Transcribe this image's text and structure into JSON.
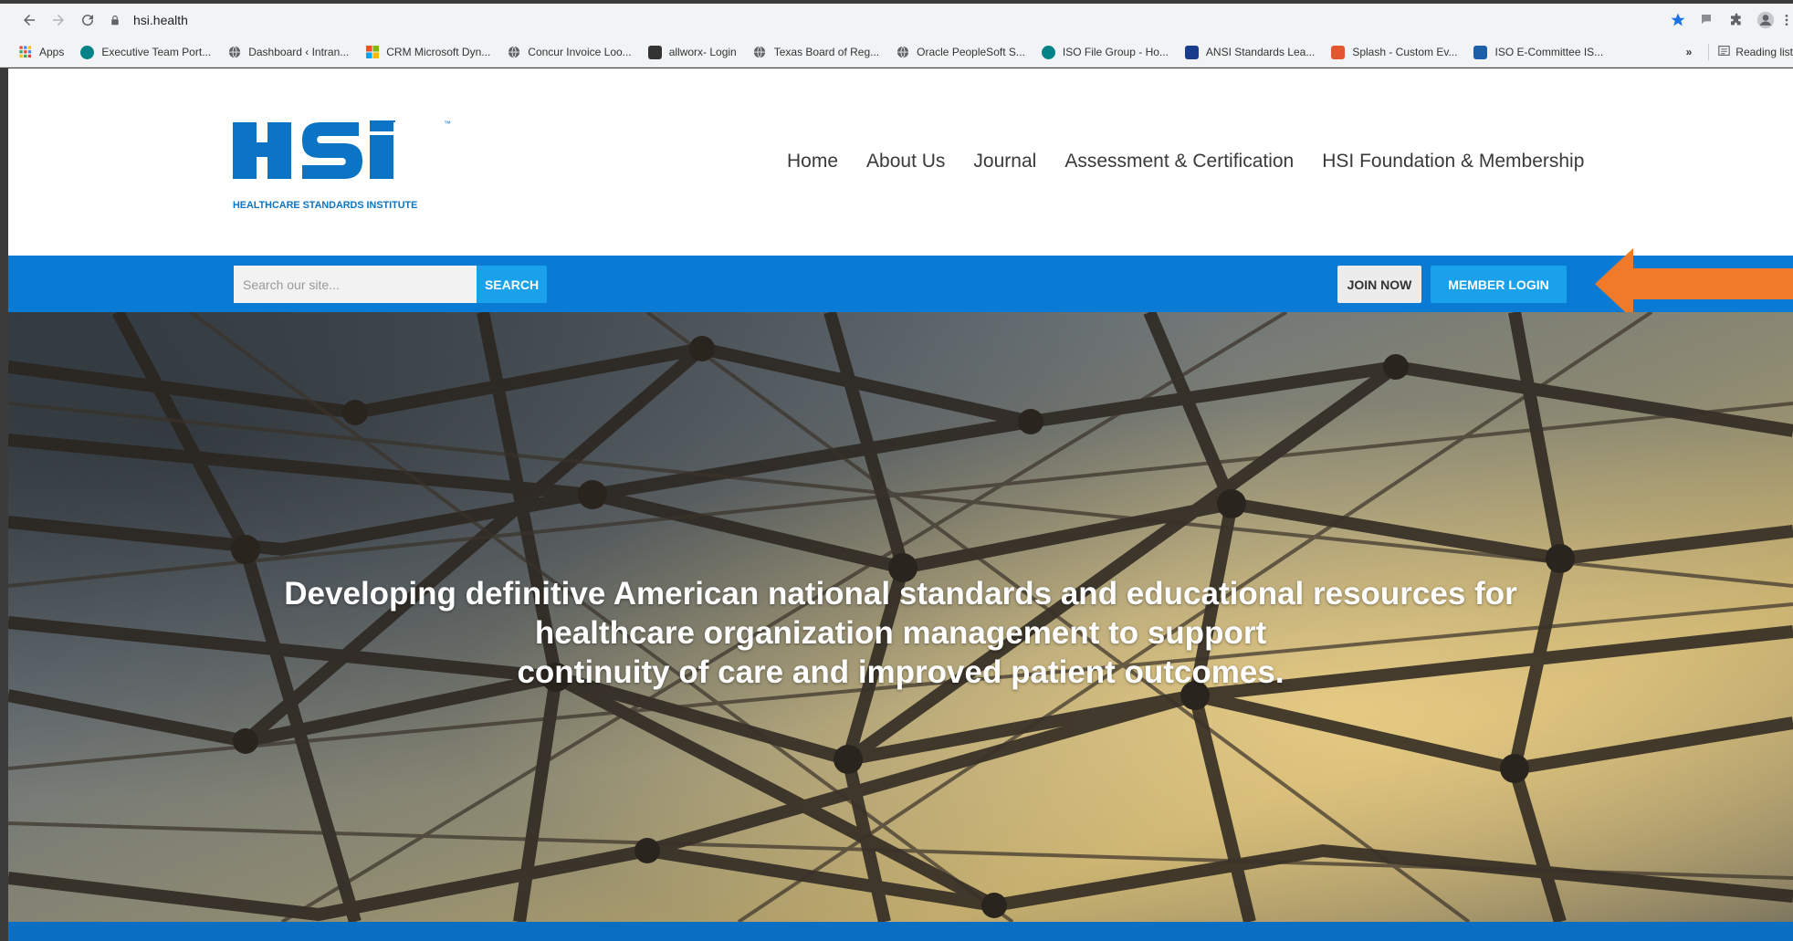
{
  "browser": {
    "url": "hsi.health",
    "bookmarks": [
      {
        "label": "Apps",
        "icon": "apps-grid-icon",
        "color": "#e8453c"
      },
      {
        "label": "Executive Team Port...",
        "icon": "sharepoint-icon",
        "color": "#038387"
      },
      {
        "label": "Dashboard ‹ Intran...",
        "icon": "globe-icon",
        "color": "#555555"
      },
      {
        "label": "CRM Microsoft Dyn...",
        "icon": "microsoft-icon",
        "color": "#f25022"
      },
      {
        "label": "Concur Invoice Loo...",
        "icon": "globe-icon",
        "color": "#555555"
      },
      {
        "label": "allworx- Login",
        "icon": "allworx-icon",
        "color": "#333333"
      },
      {
        "label": "Texas Board of Reg...",
        "icon": "globe-icon",
        "color": "#555555"
      },
      {
        "label": "Oracle PeopleSoft S...",
        "icon": "globe-icon",
        "color": "#555555"
      },
      {
        "label": "ISO File Group - Ho...",
        "icon": "sharepoint-icon",
        "color": "#038387"
      },
      {
        "label": "ANSI Standards Lea...",
        "icon": "ansi-icon",
        "color": "#1a3c8c"
      },
      {
        "label": "Splash - Custom Ev...",
        "icon": "splash-icon",
        "color": "#e4572e"
      },
      {
        "label": "ISO E-Committee IS...",
        "icon": "iso-icon",
        "color": "#1c5fa8"
      }
    ],
    "more_label": "»",
    "reading_list": "Reading list"
  },
  "site": {
    "logo_text": "HSI",
    "logo_tagline": "HEALTHCARE STANDARDS INSTITUTE",
    "logo_tm": "™",
    "nav": [
      "Home",
      "About Us",
      "Journal",
      "Assessment & Certification",
      "HSI Foundation & Membership"
    ],
    "search_placeholder": "Search our site...",
    "search_button": "SEARCH",
    "join_button": "JOIN NOW",
    "login_button": "MEMBER LOGIN",
    "hero_line1": "Developing definitive American national standards and educational resources for",
    "hero_line2": "healthcare organization management to support",
    "hero_line3": "continuity of care and improved patient outcomes."
  },
  "colors": {
    "brand_blue": "#0a7bd4",
    "accent_blue": "#19a1ec",
    "logo_blue": "#0b74c4",
    "arrow_orange": "#f07a2a"
  }
}
